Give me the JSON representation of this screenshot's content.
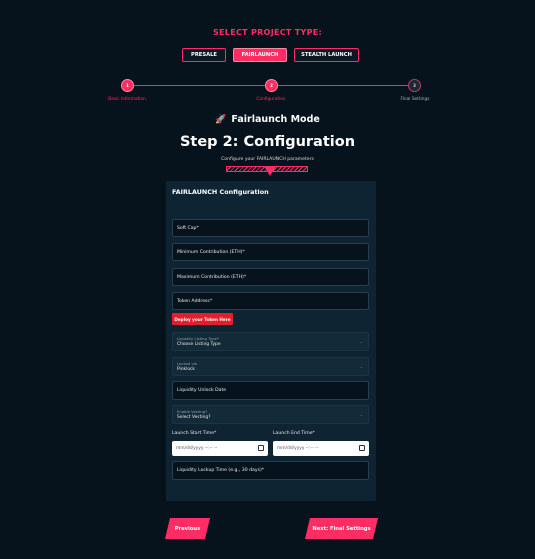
{
  "header": {
    "select_title": "SELECT PROJECT TYPE:"
  },
  "project_types": [
    {
      "label": "PRESALE",
      "active": false
    },
    {
      "label": "FAIRLAUNCH",
      "active": true
    },
    {
      "label": "STEALTH LAUNCH",
      "active": false
    }
  ],
  "steps": [
    {
      "number": "1",
      "label": "Basic Information",
      "state": "done"
    },
    {
      "number": "2",
      "label": "Configuration",
      "state": "current"
    },
    {
      "number": "3",
      "label": "Final Settings",
      "state": "pending"
    }
  ],
  "mode": {
    "icon": "rocket-icon",
    "icon_glyph": "🚀",
    "title": "Fairlaunch Mode"
  },
  "page": {
    "title": "Step 2: Configuration",
    "subtitle": "Configure your FAIRLAUNCH parameters"
  },
  "form": {
    "title": "FAIRLAUNCH Configuration",
    "soft_cap": "Soft Cap*",
    "min_contribution": "Minimum Contribution (ETH)*",
    "max_contribution": "Maximum Contribution (ETH)*",
    "token_address": "Token Address*",
    "deploy_label": "Deploy your Token Here",
    "liquidity_listing": {
      "label": "Liquidity Listing Type*",
      "value": "Choose Listing Type"
    },
    "locked_via": {
      "label": "Locked via",
      "value": "Pinklock"
    },
    "liquidity_unlock_date": "Liquidity Unlock Date",
    "enable_vesting": {
      "label": "Enable Vesting?",
      "value": "Select Vesting?"
    },
    "launch_start": {
      "label": "Launch Start Time*",
      "placeholder": "mm/dd/yyyy --:-- --"
    },
    "launch_end": {
      "label": "Launch End Time*",
      "placeholder": "mm/dd/yyyy --:-- --"
    },
    "lockup_time": "Liquidity Lockup Time (e.g., 30 days)*"
  },
  "nav": {
    "previous": "Previous",
    "next": "Next: Final Settings"
  },
  "colors": {
    "accent": "#ff2d63",
    "background": "#06131d",
    "panel": "#0f2432",
    "deploy": "#e0202f"
  }
}
